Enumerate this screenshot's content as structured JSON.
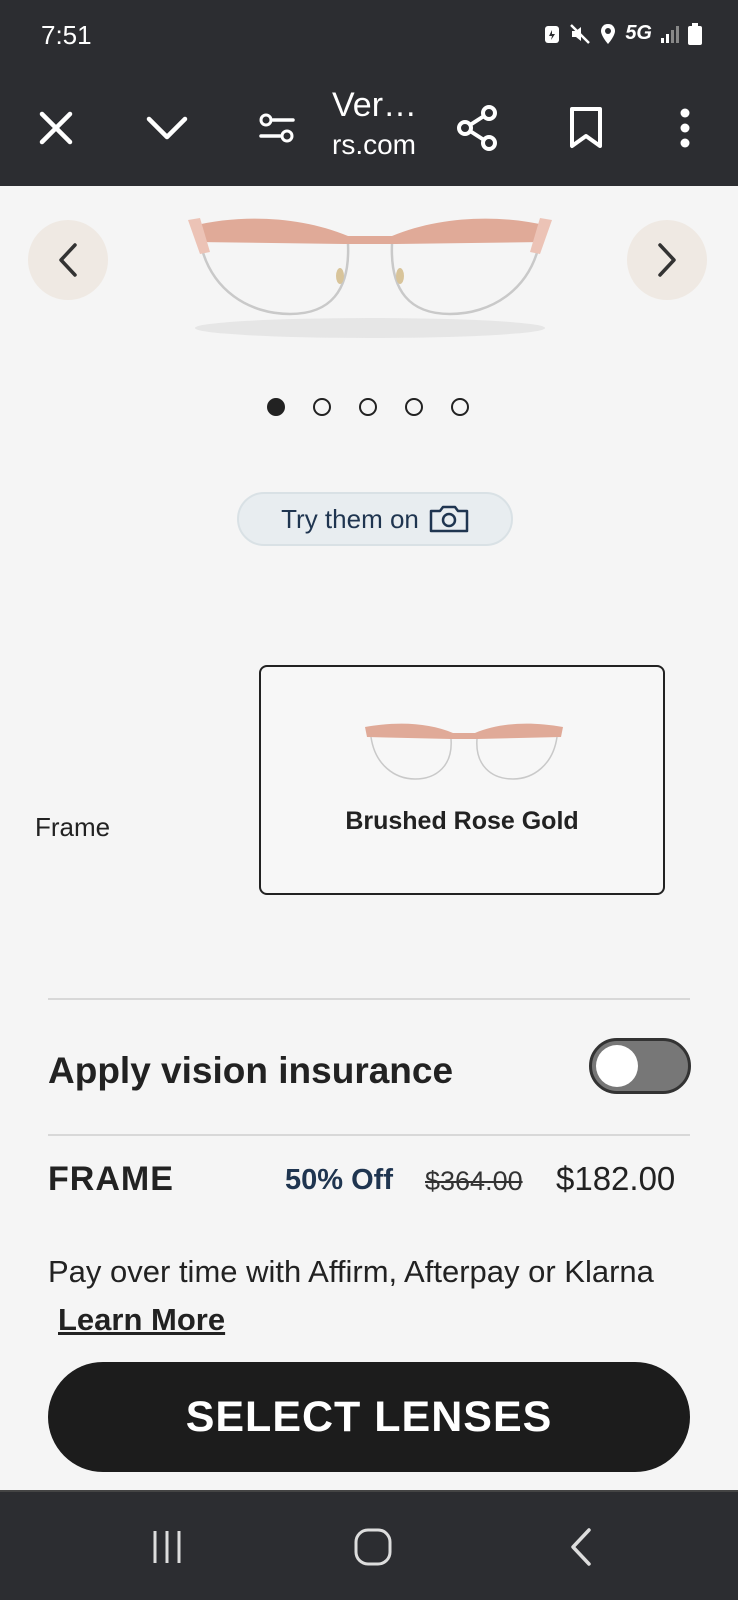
{
  "status_bar": {
    "time": "7:51",
    "network": "5G"
  },
  "toolbar": {
    "title": "Ver…",
    "domain": "rs.com"
  },
  "carousel": {
    "dot_count": 5,
    "active_index": 0
  },
  "try_on": {
    "label": "Try them on"
  },
  "frame_selector": {
    "label": "Frame",
    "selected_color": "Brushed Rose Gold"
  },
  "insurance": {
    "label": "Apply vision insurance",
    "enabled": false
  },
  "pricing": {
    "label": "FRAME",
    "discount": "50% Off",
    "original_price": "$364.00",
    "sale_price": "$182.00"
  },
  "payment": {
    "text": "Pay over time with Affirm, Afterpay or Klarna",
    "link": "Learn More"
  },
  "cta": {
    "label": "SELECT LENSES"
  },
  "colors": {
    "chrome": "#2c2d31",
    "accent_navy": "#1f3550",
    "frame_rose": "#e0aa98",
    "cta_bg": "#1c1c1c"
  },
  "icons": [
    "close-icon",
    "chevron-down-icon",
    "tune-icon",
    "share-icon",
    "bookmark-icon",
    "more-vert-icon",
    "chevron-left-icon",
    "chevron-right-icon",
    "camera-icon",
    "recents-icon",
    "home-icon",
    "back-icon"
  ]
}
